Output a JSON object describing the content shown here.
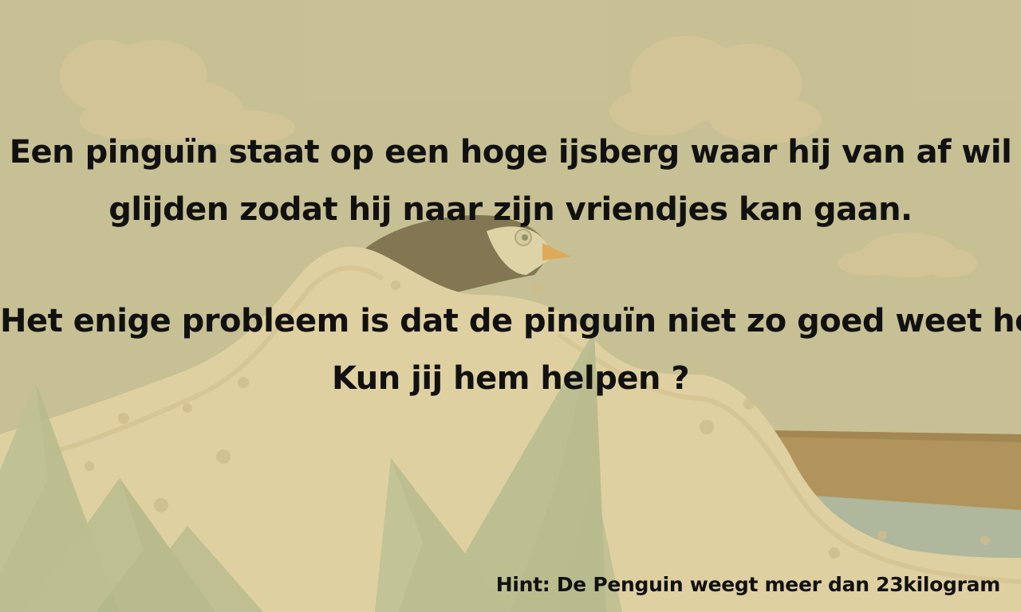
{
  "screen": {
    "background_color": "#c4be94",
    "ice_color": "#e8d6a8",
    "mountain_color": "#aab58a",
    "plank_color": "#a07a3e",
    "water_color": "#9fb0a0",
    "penguin_body_color": "#5a4c30",
    "penguin_beak_color": "#e59a3c"
  },
  "story": {
    "paragraph1": {
      "line1": "Een pinguïn staat op een hoge ijsberg waar hij van af wil",
      "line2": "glijden zodat hij naar zijn vriendjes kan gaan."
    },
    "paragraph2": {
      "line1": "Het enige probleem is dat de pinguïn niet zo goed weet hoe.",
      "line2": "Kun jij hem helpen ?"
    }
  },
  "hint": {
    "text": "Hint: De Penguin weegt meer dan 23kilogram"
  },
  "icons": {
    "penguin": "penguin-icon",
    "clouds": "cloud-icon",
    "mountains": "mountain-icon",
    "slide": "ice-slide-icon",
    "plank": "wooden-plank-icon"
  }
}
